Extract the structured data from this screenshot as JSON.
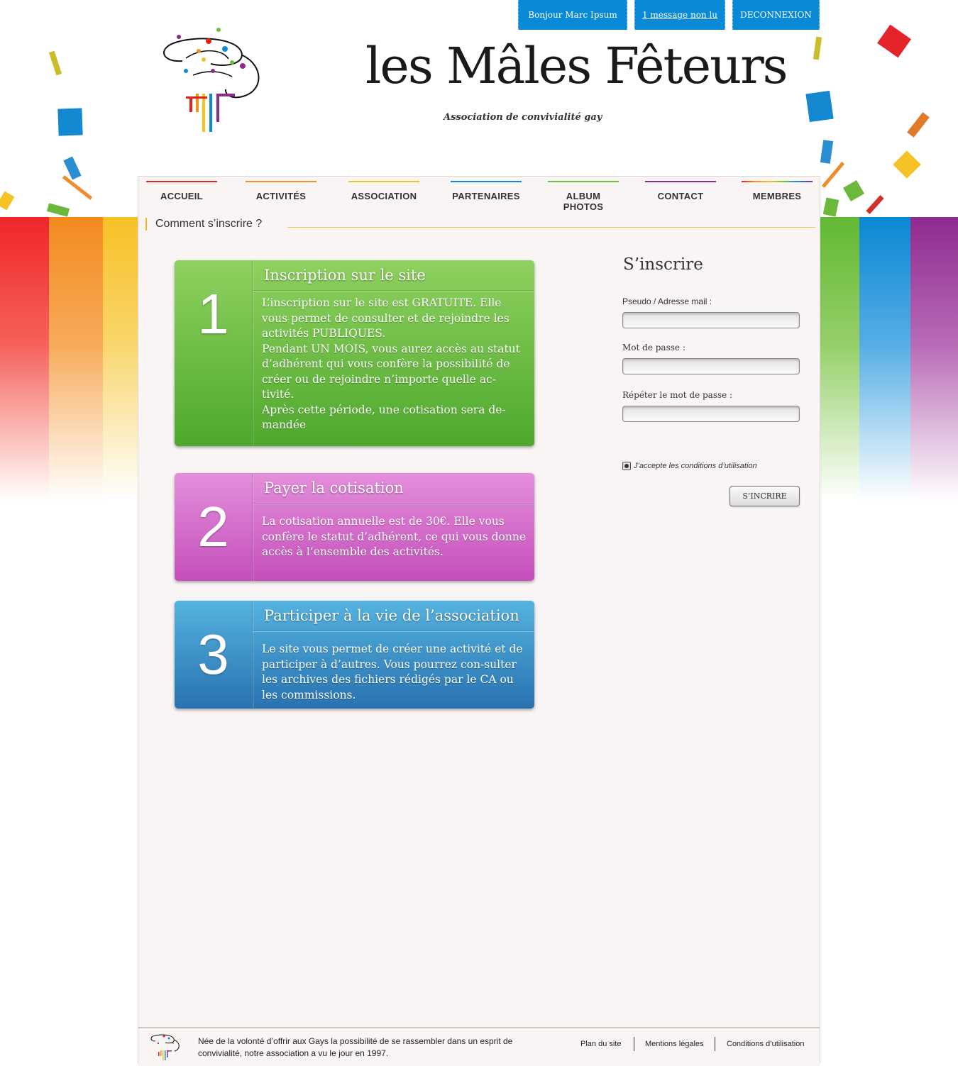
{
  "topbar": {
    "greeting": "Bonjour Marc Ipsum",
    "messages": "1 message non lu",
    "logout": "DECONNEXION"
  },
  "brand": {
    "name": "les Mâles Fêteurs",
    "tagline": "Association de convivialité gay"
  },
  "nav": {
    "items": [
      {
        "label": "ACCUEIL",
        "color": "#e2231a"
      },
      {
        "label": "ACTIVITÉS",
        "color": "#f39123"
      },
      {
        "label": "ASSOCIATION",
        "color": "#f7c21b"
      },
      {
        "label": "PARTENAIRES",
        "color": "#0e8bd5"
      },
      {
        "label": "ALBUM PHOTOS",
        "color": "#6dbf3e"
      },
      {
        "label": "CONTACT",
        "color": "#8e2a8c"
      },
      {
        "label": "MEMBRES",
        "color": "#e2231a"
      }
    ]
  },
  "page": {
    "section_title": "Comment s’inscrire ?"
  },
  "steps": [
    {
      "number": "1",
      "title": "Inscription sur le site",
      "body": "L’inscription sur le site est GRATUITE. Elle vous permet de consulter et de rejoindre les activités PUBLIQUES.\nPendant UN MOIS, vous aurez accès au statut d’adhérent qui vous confère la possibilité de créer ou de rejoindre n’importe quelle ac-tivité.\nAprès cette période, une cotisation sera de-mandée",
      "color_top": "#8fd160",
      "color_bottom": "#4ea82c"
    },
    {
      "number": "2",
      "title": "Payer la cotisation",
      "body": "La cotisation annuelle est de 30€. Elle vous confère le statut d’adhérent, ce qui vous donne accès à l’ensemble des activités.",
      "color_top": "#e48fdb",
      "color_bottom": "#c44fba"
    },
    {
      "number": "3",
      "title": "Participer à la vie de l’association",
      "body": "Le site vous permet de créer une activité et de participer à d’autres. Vous pourrez con-sulter les archives des fichiers rédigés par le CA ou les commissions.",
      "color_top": "#55b3e0",
      "color_bottom": "#2872b0"
    }
  ],
  "form": {
    "title": "S’inscrire",
    "login_label": "Pseudo / Adresse mail :",
    "login_value": "",
    "password_label": "Mot de passe :",
    "password_value": "",
    "repeat_label": "Répéter le mot de passe :",
    "repeat_value": "",
    "terms_label": "J’accepte les conditions d’utilisation",
    "submit_label": "S’INCRIRE"
  },
  "footer": {
    "text": "Née de la volonté d’offrir aux Gays la possibilité de se rassembler dans un esprit de convivialité, notre association a vu le jour en 1997.",
    "links": [
      "Plan du site",
      "Mentions légales",
      "Conditions d’utilisation"
    ]
  }
}
